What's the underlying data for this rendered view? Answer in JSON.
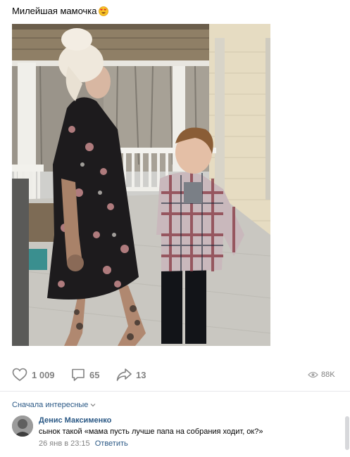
{
  "post": {
    "text": "Милейшая мамочка",
    "emoji_icon": "heart-eyes-emoji"
  },
  "actions": {
    "likes": "1 009",
    "comments": "65",
    "shares": "13",
    "views": "88K"
  },
  "comments_sort": {
    "label": "Сначала интересные"
  },
  "comment": {
    "author": "Денис Максименко",
    "text": "сынок такой «мама пусть лучше папа на собрания ходит, ок?»",
    "date": "26 янв в 23:15",
    "reply_label": "Ответить"
  },
  "colors": {
    "link": "#2a5885",
    "muted": "#828282",
    "divider": "#e7e8ec"
  }
}
